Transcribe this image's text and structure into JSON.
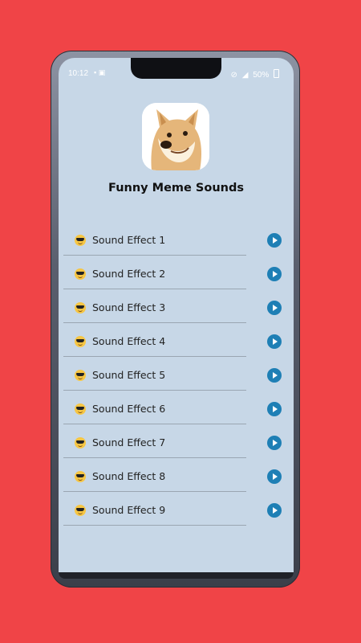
{
  "status": {
    "time": "10:12",
    "battery": "50%"
  },
  "app": {
    "title": "Funny Meme Sounds",
    "icon": "doge-icon"
  },
  "sounds": [
    {
      "label": "Sound Effect 1"
    },
    {
      "label": "Sound Effect 2"
    },
    {
      "label": "Sound Effect 3"
    },
    {
      "label": "Sound Effect 4"
    },
    {
      "label": "Sound Effect 5"
    },
    {
      "label": "Sound Effect 6"
    },
    {
      "label": "Sound Effect 7"
    },
    {
      "label": "Sound Effect 8"
    },
    {
      "label": "Sound Effect 9"
    }
  ],
  "colors": {
    "background": "#f04447",
    "screen": "#c7d7e7",
    "play_button": "#1e7fb5"
  }
}
